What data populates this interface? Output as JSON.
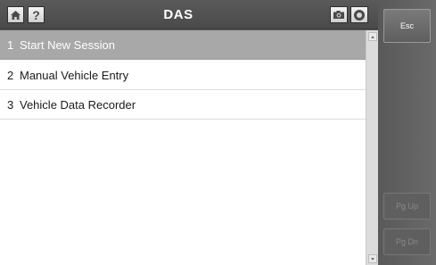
{
  "header": {
    "title": "DAS",
    "home_icon": "home-icon",
    "help_glyph": "?",
    "camera_icon": "camera-icon",
    "record_icon": "record-icon"
  },
  "menu": {
    "items": [
      {
        "num": "1",
        "label": "Start New Session",
        "selected": true
      },
      {
        "num": "2",
        "label": "Manual Vehicle Entry",
        "selected": false
      },
      {
        "num": "3",
        "label": "Vehicle Data Recorder",
        "selected": false
      }
    ]
  },
  "side": {
    "esc_label": "Esc",
    "pgup_label": "Pg Up",
    "pgdn_label": "Pg Dn"
  },
  "colors": {
    "selected_row": "#a8a8a8",
    "panel": "#5d5d5d",
    "title_text": "#ffffff"
  }
}
